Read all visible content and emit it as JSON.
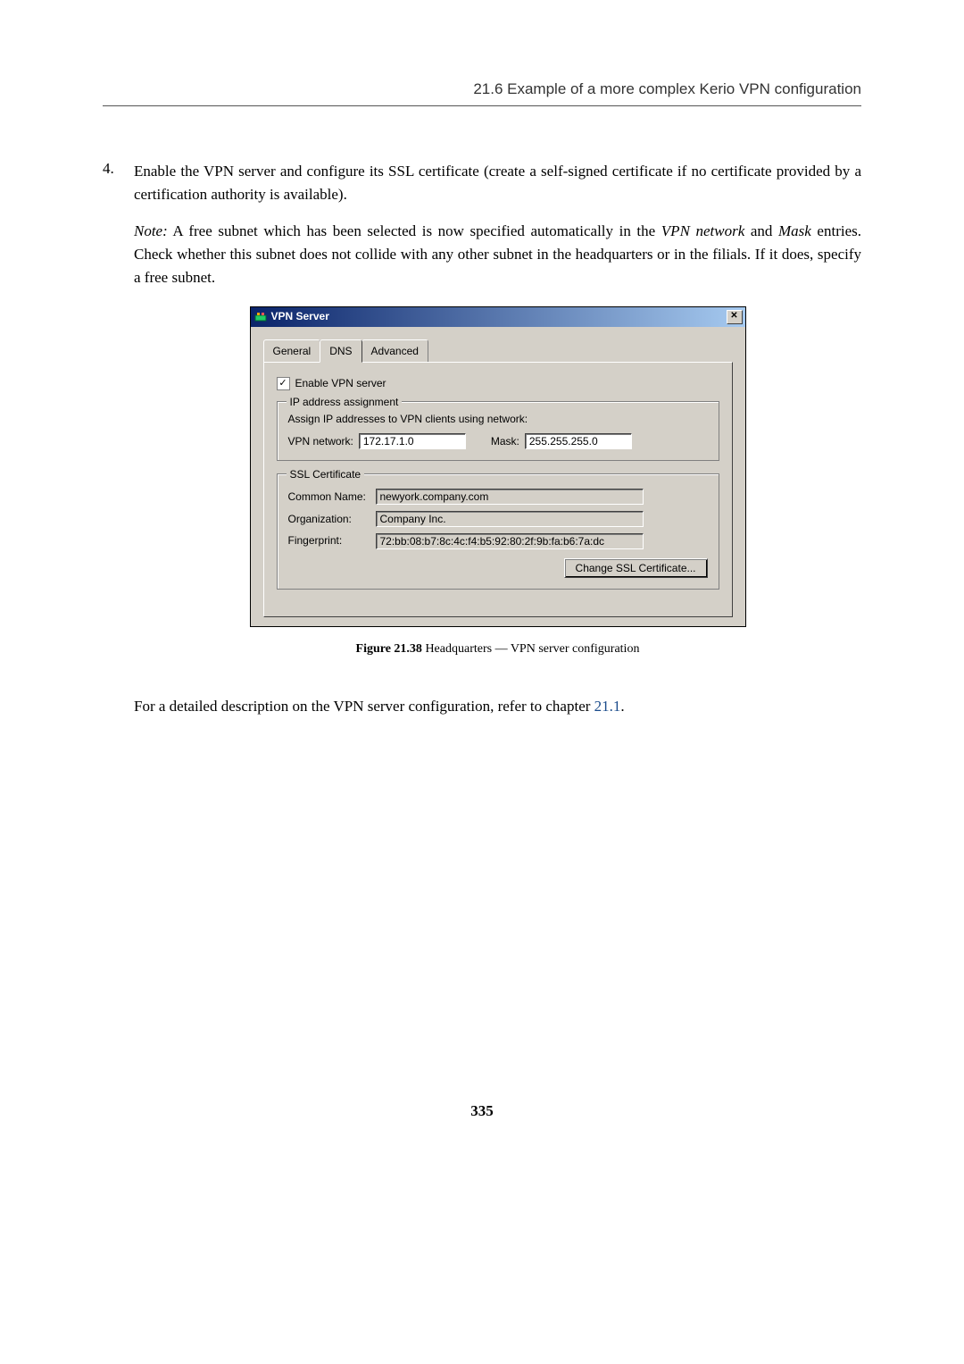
{
  "header": {
    "section": "21.6  Example of a more complex Kerio VPN configuration"
  },
  "list": {
    "num": "4.",
    "para1_a": "Enable the VPN server and configure its SSL certificate (create a self-signed certificate if no certificate provided by a certification authority is available).",
    "note_label": "Note:",
    "para2": " A free subnet which has been selected is now specified automatically in the ",
    "vpn_network": "VPN network",
    "para2_b": " and ",
    "mask": "Mask",
    "para2_c": " entries. Check whether this subnet does not collide with any other subnet in the headquarters or in the filials. If it does, specify a free subnet."
  },
  "dialog": {
    "title": "VPN Server",
    "tabs": {
      "general": "General",
      "dns": "DNS",
      "advanced": "Advanced"
    },
    "enable_label": "Enable VPN server",
    "ip_group_legend": "IP address assignment",
    "ip_group_text": "Assign IP addresses to VPN clients using network:",
    "vpn_net_label": "VPN network:",
    "vpn_net_value": "172.17.1.0",
    "mask_label": "Mask:",
    "mask_value": "255.255.255.0",
    "ssl_legend": "SSL Certificate",
    "cn_label": "Common Name:",
    "cn_value": "newyork.company.com",
    "org_label": "Organization:",
    "org_value": "Company Inc.",
    "fp_label": "Fingerprint:",
    "fp_value": "72:bb:08:b7:8c:4c:f4:b5:92:80:2f:9b:fa:b6:7a:dc",
    "change_btn": "Change SSL Certificate..."
  },
  "figure": {
    "label": "Figure 21.38",
    "caption": "   Headquarters — VPN server configuration"
  },
  "closing": {
    "a": "For a detailed description on the VPN server configuration, refer to chapter ",
    "link": "21.1",
    "b": "."
  },
  "page_number": "335"
}
